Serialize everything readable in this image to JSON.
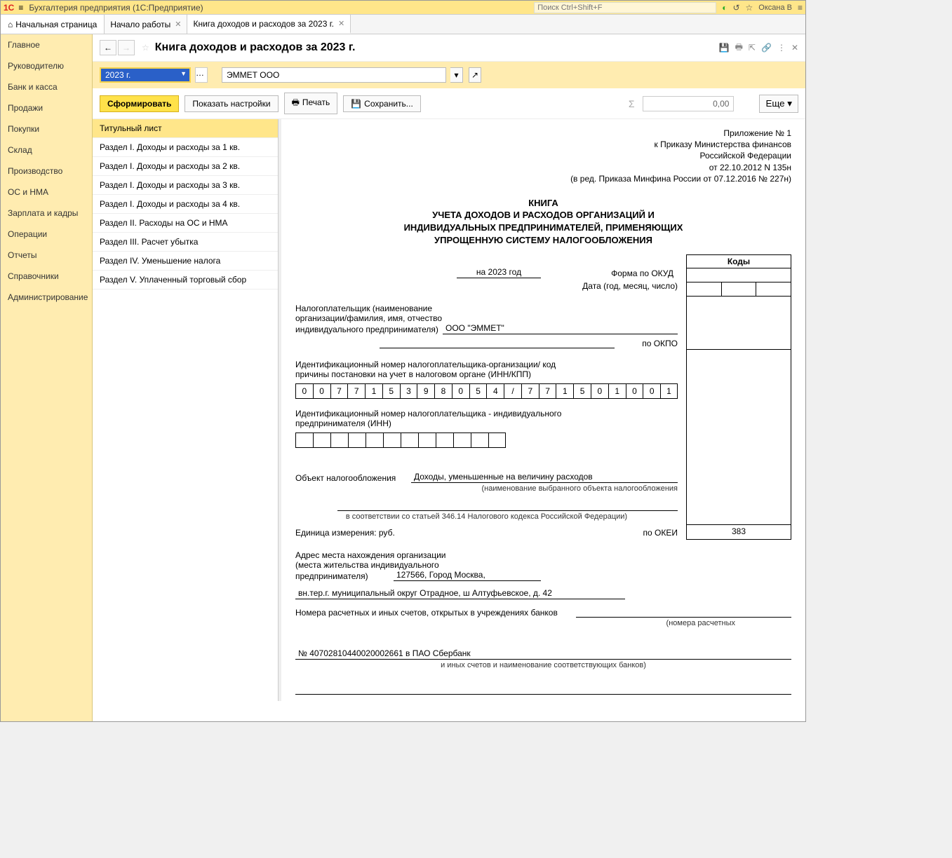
{
  "titlebar": {
    "app_title": "Бухгалтерия предприятия  (1С:Предприятие)",
    "search_placeholder": "Поиск Ctrl+Shift+F",
    "user": "Оксана В"
  },
  "tabs": {
    "home": "Начальная страница",
    "items": [
      {
        "label": "Начало работы"
      },
      {
        "label": "Книга доходов и расходов за 2023 г."
      }
    ]
  },
  "sidemenu": [
    "Главное",
    "Руководителю",
    "Банк и касса",
    "Продажи",
    "Покупки",
    "Склад",
    "Производство",
    "ОС и НМА",
    "Зарплата и кадры",
    "Операции",
    "Отчеты",
    "Справочники",
    "Администрирование"
  ],
  "pagehdr": {
    "title": "Книга доходов и расходов за 2023 г."
  },
  "params": {
    "period": "2023 г.",
    "org": "ЭММЕТ ООО"
  },
  "toolbar": {
    "generate": "Сформировать",
    "show_settings": "Показать настройки",
    "print": "Печать",
    "save": "Сохранить...",
    "sum": "0,00",
    "more": "Еще"
  },
  "sections": [
    "Титульный лист",
    "Раздел I. Доходы и расходы за 1 кв.",
    "Раздел I. Доходы и расходы за 2 кв.",
    "Раздел I. Доходы и расходы за 3 кв.",
    "Раздел I. Доходы и расходы за 4 кв.",
    "Раздел II. Расходы на ОС и НМА",
    "Раздел III. Расчет убытка",
    "Раздел IV. Уменьшение налога",
    "Раздел V. Уплаченный торговый сбор"
  ],
  "doc": {
    "appendix": {
      "l1": "Приложение № 1",
      "l2": "к Приказу Министерства финансов",
      "l3": "Российской Федерации",
      "l4": "от 22.10.2012 N 135н",
      "l5": "(в ред. Приказа Минфина России от 07.12.2016 № 227н)"
    },
    "title": {
      "l1": "КНИГА",
      "l2": "УЧЕТА ДОХОДОВ И РАСХОДОВ ОРГАНИЗАЦИЙ И",
      "l3": "ИНДИВИДУАЛЬНЫХ ПРЕДПРИНИМАТЕЛЕЙ, ПРИМЕНЯЮЩИХ",
      "l4": "УПРОЩЕННУЮ СИСТЕМУ НАЛОГООБЛОЖЕНИЯ"
    },
    "year_label": "на 2023 год",
    "form_okud": "Форма по ОКУД",
    "date_label": "Дата (год, месяц, число)",
    "taxpayer_label_l1": "Налогоплательщик (наименование",
    "taxpayer_label_l2": "организации/фамилия, имя, отчество",
    "taxpayer_label_l3": "индивидуального предпринимателя)",
    "taxpayer_value": "ООО \"ЭММЕТ\"",
    "okpo_label": "по ОКПО",
    "inn_kpp_label_l1": "Идентификационный номер налогоплательщика-организации/ код",
    "inn_kpp_label_l2": "причины постановки на учет в налоговом органе (ИНН/КПП)",
    "inn_kpp": [
      "0",
      "0",
      "7",
      "7",
      "1",
      "5",
      "3",
      "9",
      "8",
      "0",
      "5",
      "4",
      "/",
      "7",
      "7",
      "1",
      "5",
      "0",
      "1",
      "0",
      "0",
      "1"
    ],
    "inn_ip_label_l1": "Идентификационный номер налогоплательщика - индивидуального",
    "inn_ip_label_l2": "предпринимателя (ИНН)",
    "inn_ip_cells": 12,
    "tax_object_label": "Объект налогообложения",
    "tax_object_value": "Доходы, уменьшенные на величину расходов",
    "tax_object_note1": "(наименование выбранного объекта налогообложения",
    "tax_object_note2": "в соответствии со статьей 346.14 Налогового кодекса Российской Федерации)",
    "unit_label": "Единица измерения:   руб.",
    "okei_label": "по ОКЕИ",
    "okei_value": "383",
    "codes_header": "Коды",
    "address_label_l1": "Адрес места нахождения организации",
    "address_label_l2": "(места жительства индивидуального",
    "address_label_l3": "предпринимателя)",
    "address_value_l1": "127566, Город Москва,",
    "address_value_l2": "вн.тер.г. муниципальный округ Отрадное, ш Алтуфьевское, д. 42",
    "accounts_label": "Номера расчетных и иных счетов, открытых в учреждениях банков",
    "accounts_note1": "(номера расчетных",
    "accounts_value": "№ 40702810440020002661 в ПАО Сбербанк",
    "accounts_note2": "и иных счетов и наименование соответствующих банков)"
  }
}
